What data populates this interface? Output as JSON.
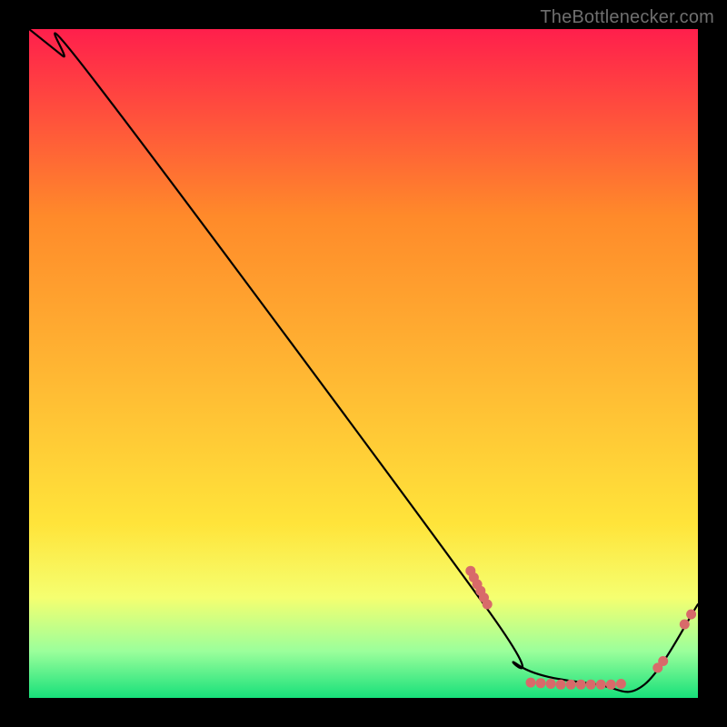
{
  "watermark": "TheBottlenecker.com",
  "chart_data": {
    "type": "line",
    "title": "",
    "xlabel": "",
    "ylabel": "",
    "xlim": [
      0,
      100
    ],
    "ylim": [
      0,
      100
    ],
    "grid": false,
    "legend": false,
    "colors": {
      "gradient_top": "#ff1f4c",
      "gradient_mid_upper": "#ff8a2a",
      "gradient_mid": "#ffe43a",
      "gradient_mid_lower": "#f5ff70",
      "gradient_lower": "#9bff9b",
      "gradient_bottom": "#17e07a",
      "line": "#000000",
      "marker": "#d86a6a"
    },
    "series": [
      {
        "name": "curve",
        "x": [
          0,
          5,
          10,
          68,
          73,
          85,
          92,
          100
        ],
        "y": [
          100,
          96,
          92,
          14,
          5,
          2,
          2,
          14
        ]
      }
    ],
    "markers": [
      {
        "group": "steep-cluster",
        "points": [
          {
            "x": 66,
            "y": 19
          },
          {
            "x": 66.5,
            "y": 18
          },
          {
            "x": 67,
            "y": 17
          },
          {
            "x": 67.5,
            "y": 16
          },
          {
            "x": 68,
            "y": 15
          },
          {
            "x": 68.5,
            "y": 14
          }
        ]
      },
      {
        "group": "valley-floor",
        "points": [
          {
            "x": 75,
            "y": 2.3
          },
          {
            "x": 76.5,
            "y": 2.2
          },
          {
            "x": 78,
            "y": 2.1
          },
          {
            "x": 79.5,
            "y": 2.0
          },
          {
            "x": 81,
            "y": 2.0
          },
          {
            "x": 82.5,
            "y": 2.0
          },
          {
            "x": 84,
            "y": 2.0
          },
          {
            "x": 85.5,
            "y": 2.0
          },
          {
            "x": 87,
            "y": 2.0
          },
          {
            "x": 88.5,
            "y": 2.1
          }
        ]
      },
      {
        "group": "rise-cluster",
        "points": [
          {
            "x": 94,
            "y": 4.5
          },
          {
            "x": 94.8,
            "y": 5.5
          },
          {
            "x": 98,
            "y": 11
          },
          {
            "x": 99,
            "y": 12.5
          }
        ]
      }
    ]
  }
}
